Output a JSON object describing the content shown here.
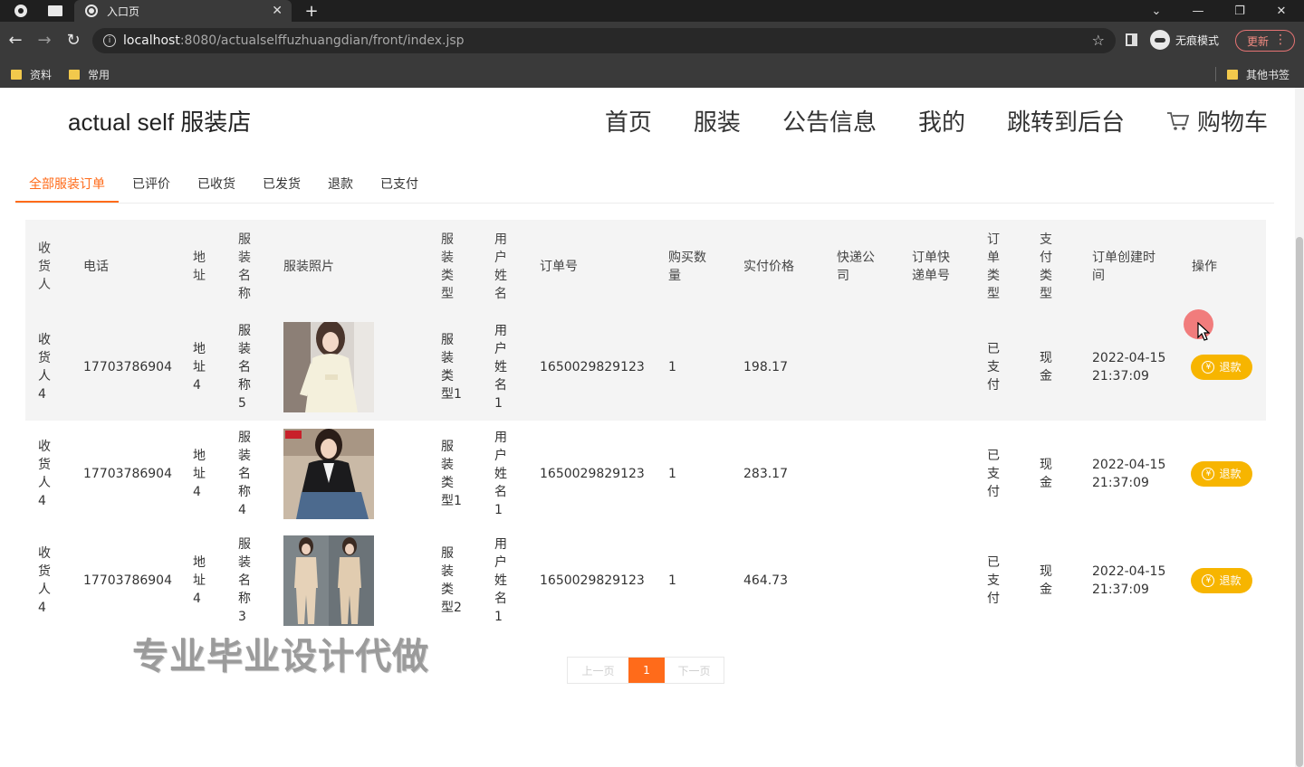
{
  "browser": {
    "tab_title": "入口页",
    "new_tab": "+",
    "url_host": "localhost",
    "url_rest": ":8080/actualselffuzhuangdian/front/index.jsp",
    "incognito_label": "无痕模式",
    "update_label": "更新",
    "bookmarks": [
      "资料",
      "常用"
    ],
    "other_bookmarks": "其他书签"
  },
  "site": {
    "brand": "actual self 服装店",
    "nav": [
      "首页",
      "服装",
      "公告信息",
      "我的",
      "跳转到后台",
      "购物车"
    ]
  },
  "order_tabs": [
    "全部服装订单",
    "已评价",
    "已收货",
    "已发货",
    "退款",
    "已支付"
  ],
  "table": {
    "headers": [
      "收货人",
      "电话",
      "地址",
      "服装名称",
      "服装照片",
      "服装类型",
      "用户姓名",
      "订单号",
      "购买数量",
      "实付价格",
      "快递公司",
      "订单快递单号",
      "订单类型",
      "支付类型",
      "订单创建时间",
      "操作"
    ],
    "rows": [
      {
        "receiver": "收货人4",
        "phone": "17703786904",
        "address": "地址4",
        "name": "服装名称5",
        "type": "服装类型1",
        "user": "用户姓名1",
        "order_no": "1650029829123",
        "qty": "1",
        "price": "198.17",
        "courier": "",
        "tracking": "",
        "order_type": "已支付",
        "pay_type": "现金",
        "created": "2022-04-15 21:37:09",
        "action": "退款"
      },
      {
        "receiver": "收货人4",
        "phone": "17703786904",
        "address": "地址4",
        "name": "服装名称4",
        "type": "服装类型1",
        "user": "用户姓名1",
        "order_no": "1650029829123",
        "qty": "1",
        "price": "283.17",
        "courier": "",
        "tracking": "",
        "order_type": "已支付",
        "pay_type": "现金",
        "created": "2022-04-15 21:37:09",
        "action": "退款"
      },
      {
        "receiver": "收货人4",
        "phone": "17703786904",
        "address": "地址4",
        "name": "服装名称3",
        "type": "服装类型2",
        "user": "用户姓名1",
        "order_no": "1650029829123",
        "qty": "1",
        "price": "464.73",
        "courier": "",
        "tracking": "",
        "order_type": "已支付",
        "pay_type": "现金",
        "created": "2022-04-15 21:37:09",
        "action": "退款"
      }
    ]
  },
  "pager": {
    "prev": "上一页",
    "current": "1",
    "next": "下一页"
  },
  "watermark": "专业毕业设计代做",
  "colors": {
    "accent": "#ff6b1a",
    "refund": "#f7b500"
  }
}
